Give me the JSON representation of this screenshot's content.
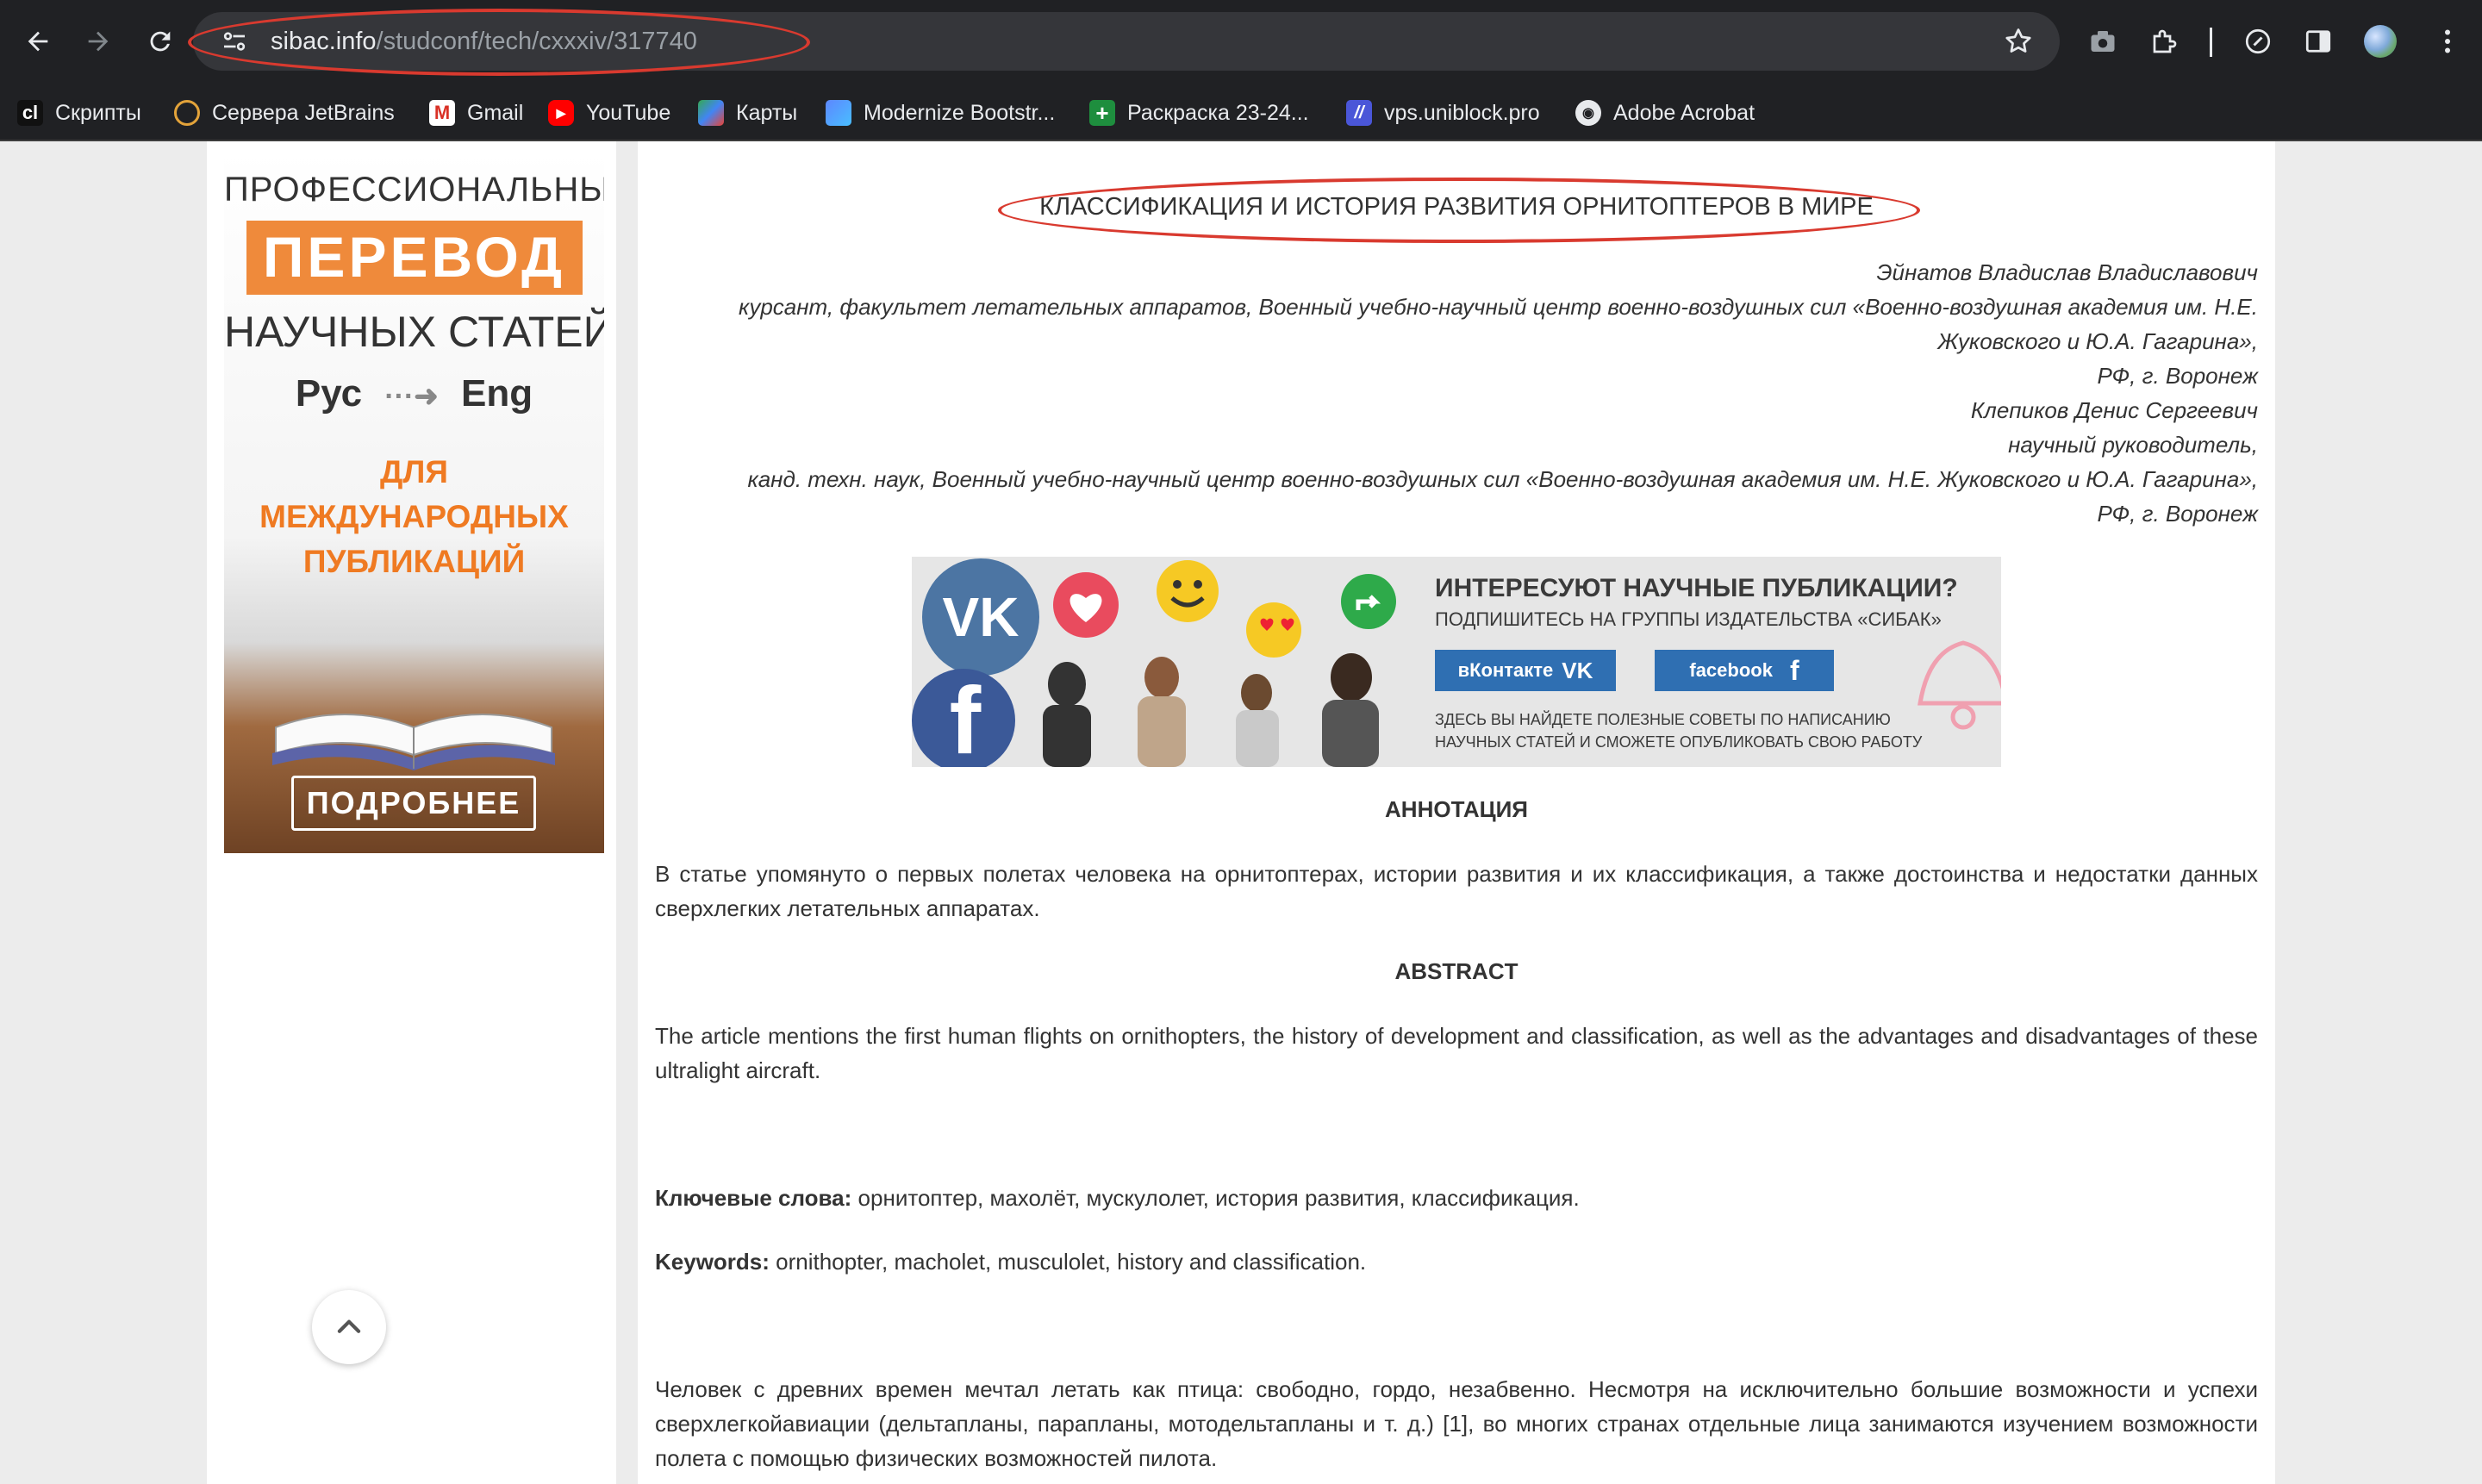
{
  "browser": {
    "url_host": "sibac.info",
    "url_path": "/studconf/tech/cxxxiv/317740",
    "bookmarks": [
      {
        "label": "Скрипты",
        "icon": "cl"
      },
      {
        "label": "Сервера JetBrains",
        "icon": ""
      },
      {
        "label": "Gmail",
        "icon": ""
      },
      {
        "label": "YouTube",
        "icon": ""
      },
      {
        "label": "Карты",
        "icon": ""
      },
      {
        "label": "Modernize Bootstr...",
        "icon": ""
      },
      {
        "label": "Раскраска 23-24...",
        "icon": ""
      },
      {
        "label": "vps.uniblock.pro",
        "icon": ""
      },
      {
        "label": "Adobe Acrobat",
        "icon": ""
      }
    ]
  },
  "ad": {
    "line1": "ПРОФЕССИОНАЛЬНЫЙ",
    "line2": "ПЕРЕВОД",
    "line3": "НАУЧНЫХ СТАТЕЙ",
    "lang_from": "Рус",
    "lang_to": "Eng",
    "line5": "ДЛЯ МЕЖДУНАРОДНЫХ ПУБЛИКАЦИЙ",
    "button": "ПОДРОБНЕЕ"
  },
  "article": {
    "title": "КЛАССИФИКАЦИЯ И ИСТОРИЯ РАЗВИТИЯ ОРНИТОПТЕРОВ В МИРЕ",
    "authors": [
      "Эйнатов Владислав Владиславович",
      "курсант, факультет летательных аппаратов, Военный учебно-научный центр военно-воздушных сил «Военно-воздушная академия им. Н.Е.",
      "Жуковского и Ю.А. Гагарина»,",
      "РФ, г. Воронеж",
      "Клепиков Денис Сергеевич",
      "научный руководитель,",
      "канд. техн. наук, Военный учебно-научный центр военно-воздушных сил «Военно-воздушная академия им. Н.Е. Жуковского и Ю.А. Гагарина»,",
      "РФ, г. Воронеж"
    ],
    "banner": {
      "heading": "ИНТЕРЕСУЮТ НАУЧНЫЕ ПУБЛИКАЦИИ?",
      "subheading": "ПОДПИШИТЕСЬ НА ГРУППЫ ИЗДАТЕЛЬСТВА «СИБАК»",
      "vk_button": "вКонтакте",
      "fb_button": "facebook",
      "footer_line1": "ЗДЕСЬ ВЫ НАЙДЕТЕ ПОЛЕЗНЫЕ СОВЕТЫ ПО НАПИСАНИЮ",
      "footer_line2": "НАУЧНЫХ СТАТЕЙ И СМОЖЕТЕ ОПУБЛИКОВАТЬ СВОЮ РАБОТУ"
    },
    "annotation_heading": "АННОТАЦИЯ",
    "annotation_text": "В статье упомянуто о первых полетах человека на орнитоптерах, истории развития и их классификация, а также достоинства и недостатки данных сверхлегких летательных аппаратах.",
    "abstract_heading": "ABSTRACT",
    "abstract_text": "The article mentions the first human flights on ornithopters, the history of development and classification, as well as the advantages and disadvantages of these ultralight aircraft.",
    "keywords_ru_label": "Ключевые слова:",
    "keywords_ru": " орнитоптер, махолёт, мускулолет, история развития, классификация.",
    "keywords_en_label": "Keywords:",
    "keywords_en": " ornithopter, macholet, musculolet, history and classification.",
    "body_text": "Человек с древних времен мечтал летать как птица: свободно, гордо, незабвенно. Несмотря на исключительно большие возможности и успехи сверхлегкойавиации (дельтапланы, парапланы, мотодельтапланы и т. д.) [1], во многих странах отдельные лица занимаются изучением возможности полета с помощью физических возможностей пилота."
  },
  "colors": {
    "chrome_bg": "#202124",
    "omnibox_bg": "#35363a",
    "annotation_red": "#d93a2f",
    "ad_orange": "#ef8a3b",
    "banner_blue": "#2f6fb2"
  }
}
